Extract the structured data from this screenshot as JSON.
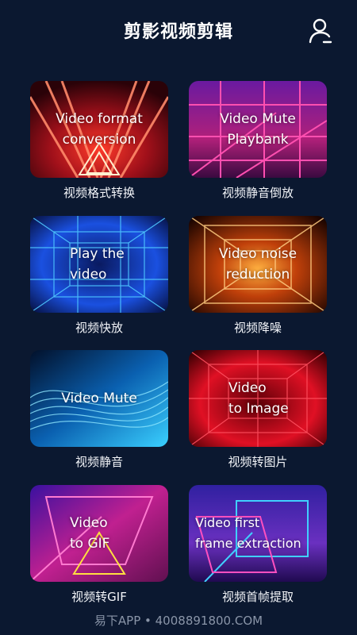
{
  "header": {
    "title": "剪影视频剪辑"
  },
  "cards": [
    {
      "overlay": [
        "Video format",
        "conversion"
      ],
      "label": "视频格式转换"
    },
    {
      "overlay": [
        "Video Mute",
        "Playbank"
      ],
      "label": "视频静音倒放"
    },
    {
      "overlay": [
        "Play the",
        "video"
      ],
      "label": "视频快放"
    },
    {
      "overlay": [
        "Video noise",
        "reduction"
      ],
      "label": "视频降噪"
    },
    {
      "overlay": [
        "Video Mute"
      ],
      "label": "视频静音"
    },
    {
      "overlay": [
        "Video",
        "to Image"
      ],
      "label": "视频转图片"
    },
    {
      "overlay": [
        "Video",
        "to GIF"
      ],
      "label": "视频转GIF"
    },
    {
      "overlay": [
        "Video first",
        "frame extraction"
      ],
      "label": "视频首帧提取"
    }
  ],
  "footer": {
    "text": "易下APP • 4008891800.COM"
  },
  "icons": {
    "user": "user-icon"
  },
  "colors": {
    "background": "#0b1830",
    "footer_text": "#8a95a8"
  }
}
